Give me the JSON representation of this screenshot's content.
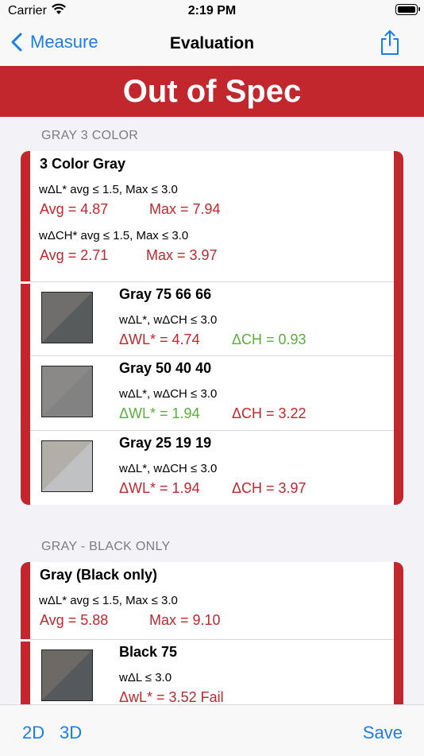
{
  "status": {
    "carrier": "Carrier",
    "time": "2:19 PM"
  },
  "nav": {
    "back_label": "Measure",
    "title": "Evaluation"
  },
  "banner": "Out of Spec",
  "sections": [
    {
      "header": "GRAY 3 COLOR",
      "title": "3 Color Gray",
      "criteria": [
        {
          "text": "wΔL* avg ≤ 1.5, Max ≤ 3.0",
          "avg": "Avg = 4.87",
          "max": "Max = 7.94"
        },
        {
          "text": "wΔCH* avg ≤ 1.5, Max ≤ 3.0",
          "avg": "Avg = 2.71",
          "max": "Max = 3.97"
        }
      ],
      "patches": [
        {
          "name": "Gray 75 66 66",
          "criteria": "wΔL*, wΔCH ≤ 3.0",
          "v1": "ΔWL* = 4.74",
          "v1_status": "red",
          "v2": "ΔCH = 0.93",
          "v2_status": "green",
          "color_a": "#6f6e6c",
          "color_b": "#585b5b"
        },
        {
          "name": "Gray 50 40 40",
          "criteria": "wΔL*, wΔCH ≤ 3.0",
          "v1": "ΔWL* = 1.94",
          "v1_status": "green",
          "v2": "ΔCH = 3.22",
          "v2_status": "red",
          "color_a": "#8a8987",
          "color_b": "#828283"
        },
        {
          "name": "Gray 25 19 19",
          "criteria": "wΔL*, wΔCH ≤ 3.0",
          "v1": "ΔWL* = 1.94",
          "v1_status": "red",
          "v2": "ΔCH = 3.97",
          "v2_status": "red",
          "color_a": "#b2afa9",
          "color_b": "#bfc1c2"
        }
      ]
    },
    {
      "header": "GRAY - BLACK ONLY",
      "title": "Gray (Black only)",
      "criteria": [
        {
          "text": "wΔL* avg ≤ 1.5, Max ≤ 3.0",
          "avg": "Avg = 5.88",
          "max": "Max = 9.10"
        }
      ],
      "patches": [
        {
          "name": "Black 75",
          "criteria": "wΔL ≤ 3.0",
          "v1": "ΔwL* = 3.52 Fail",
          "v1_status": "red",
          "color_a": "#6d6a65",
          "color_b": "#55595b"
        }
      ]
    }
  ],
  "tabbar": {
    "btn_2d": "2D",
    "btn_3d": "3D",
    "save": "Save"
  },
  "colors": {
    "accent": "#1a7ee6",
    "fail": "#c1272d",
    "pass": "#5cae3e",
    "section_header": "#7c7c80"
  },
  "icons": [
    "chevron-left-icon",
    "share-icon",
    "wifi-icon",
    "battery-icon"
  ]
}
